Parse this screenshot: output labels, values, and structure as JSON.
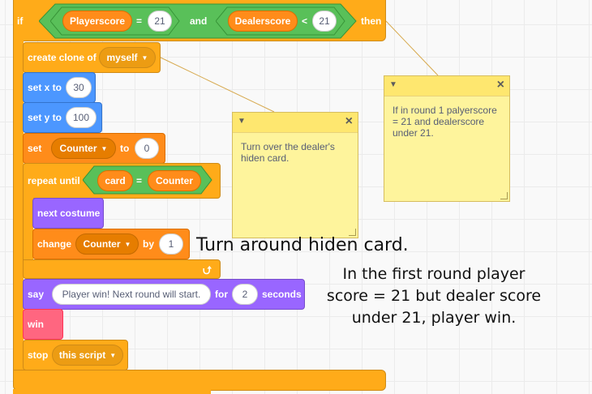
{
  "script": {
    "if_label": "if",
    "and_label": "and",
    "then_label": "then",
    "player_score_var": "Playerscore",
    "eq_sign": "=",
    "lt_sign": "<",
    "player_score_value": "21",
    "dealer_score_var": "Dealerscore",
    "dealer_score_value": "21",
    "create_clone_label": "create clone of",
    "clone_target": "myself",
    "set_x_label": "set x to",
    "set_x_value": "30",
    "set_y_label": "set y to",
    "set_y_value": "100",
    "set_label": "set",
    "set_var": "Counter",
    "to_label": "to",
    "set_value": "0",
    "repeat_until_label": "repeat until",
    "card_var": "card",
    "counter_var": "Counter",
    "next_costume_label": "next costume",
    "change_label": "change",
    "change_var": "Counter",
    "by_label": "by",
    "change_value": "1",
    "loop_arrow": "⮍",
    "say_label": "say",
    "say_text": "Player win! Next round will start.",
    "for_label": "for",
    "say_seconds": "2",
    "seconds_label": "seconds",
    "win_label": "win",
    "stop_label": "stop",
    "stop_option": "this script"
  },
  "notes": [
    {
      "text": "Turn over the dealer's hiden card."
    },
    {
      "text": "If in round 1 palyerscore = 21 and dealerscore under 21."
    }
  ],
  "annotations": {
    "hidden_card": "Turn around hiden card.",
    "first_round_line1": "In the first round player",
    "first_round_line2": "score = 21 but dealer score",
    "first_round_line3": "under 21, player win."
  },
  "icons": {
    "dropdown": "triangle-down-icon",
    "close": "close-icon",
    "collapse": "collapse-icon",
    "loop": "loop-arrow-icon"
  },
  "colors": {
    "control": "#ffab19",
    "motion": "#4c97ff",
    "variables": "#ff8c1a",
    "looks": "#9966ff",
    "operators": "#59c059",
    "custom": "#ff6680",
    "note": "#fef49c"
  }
}
